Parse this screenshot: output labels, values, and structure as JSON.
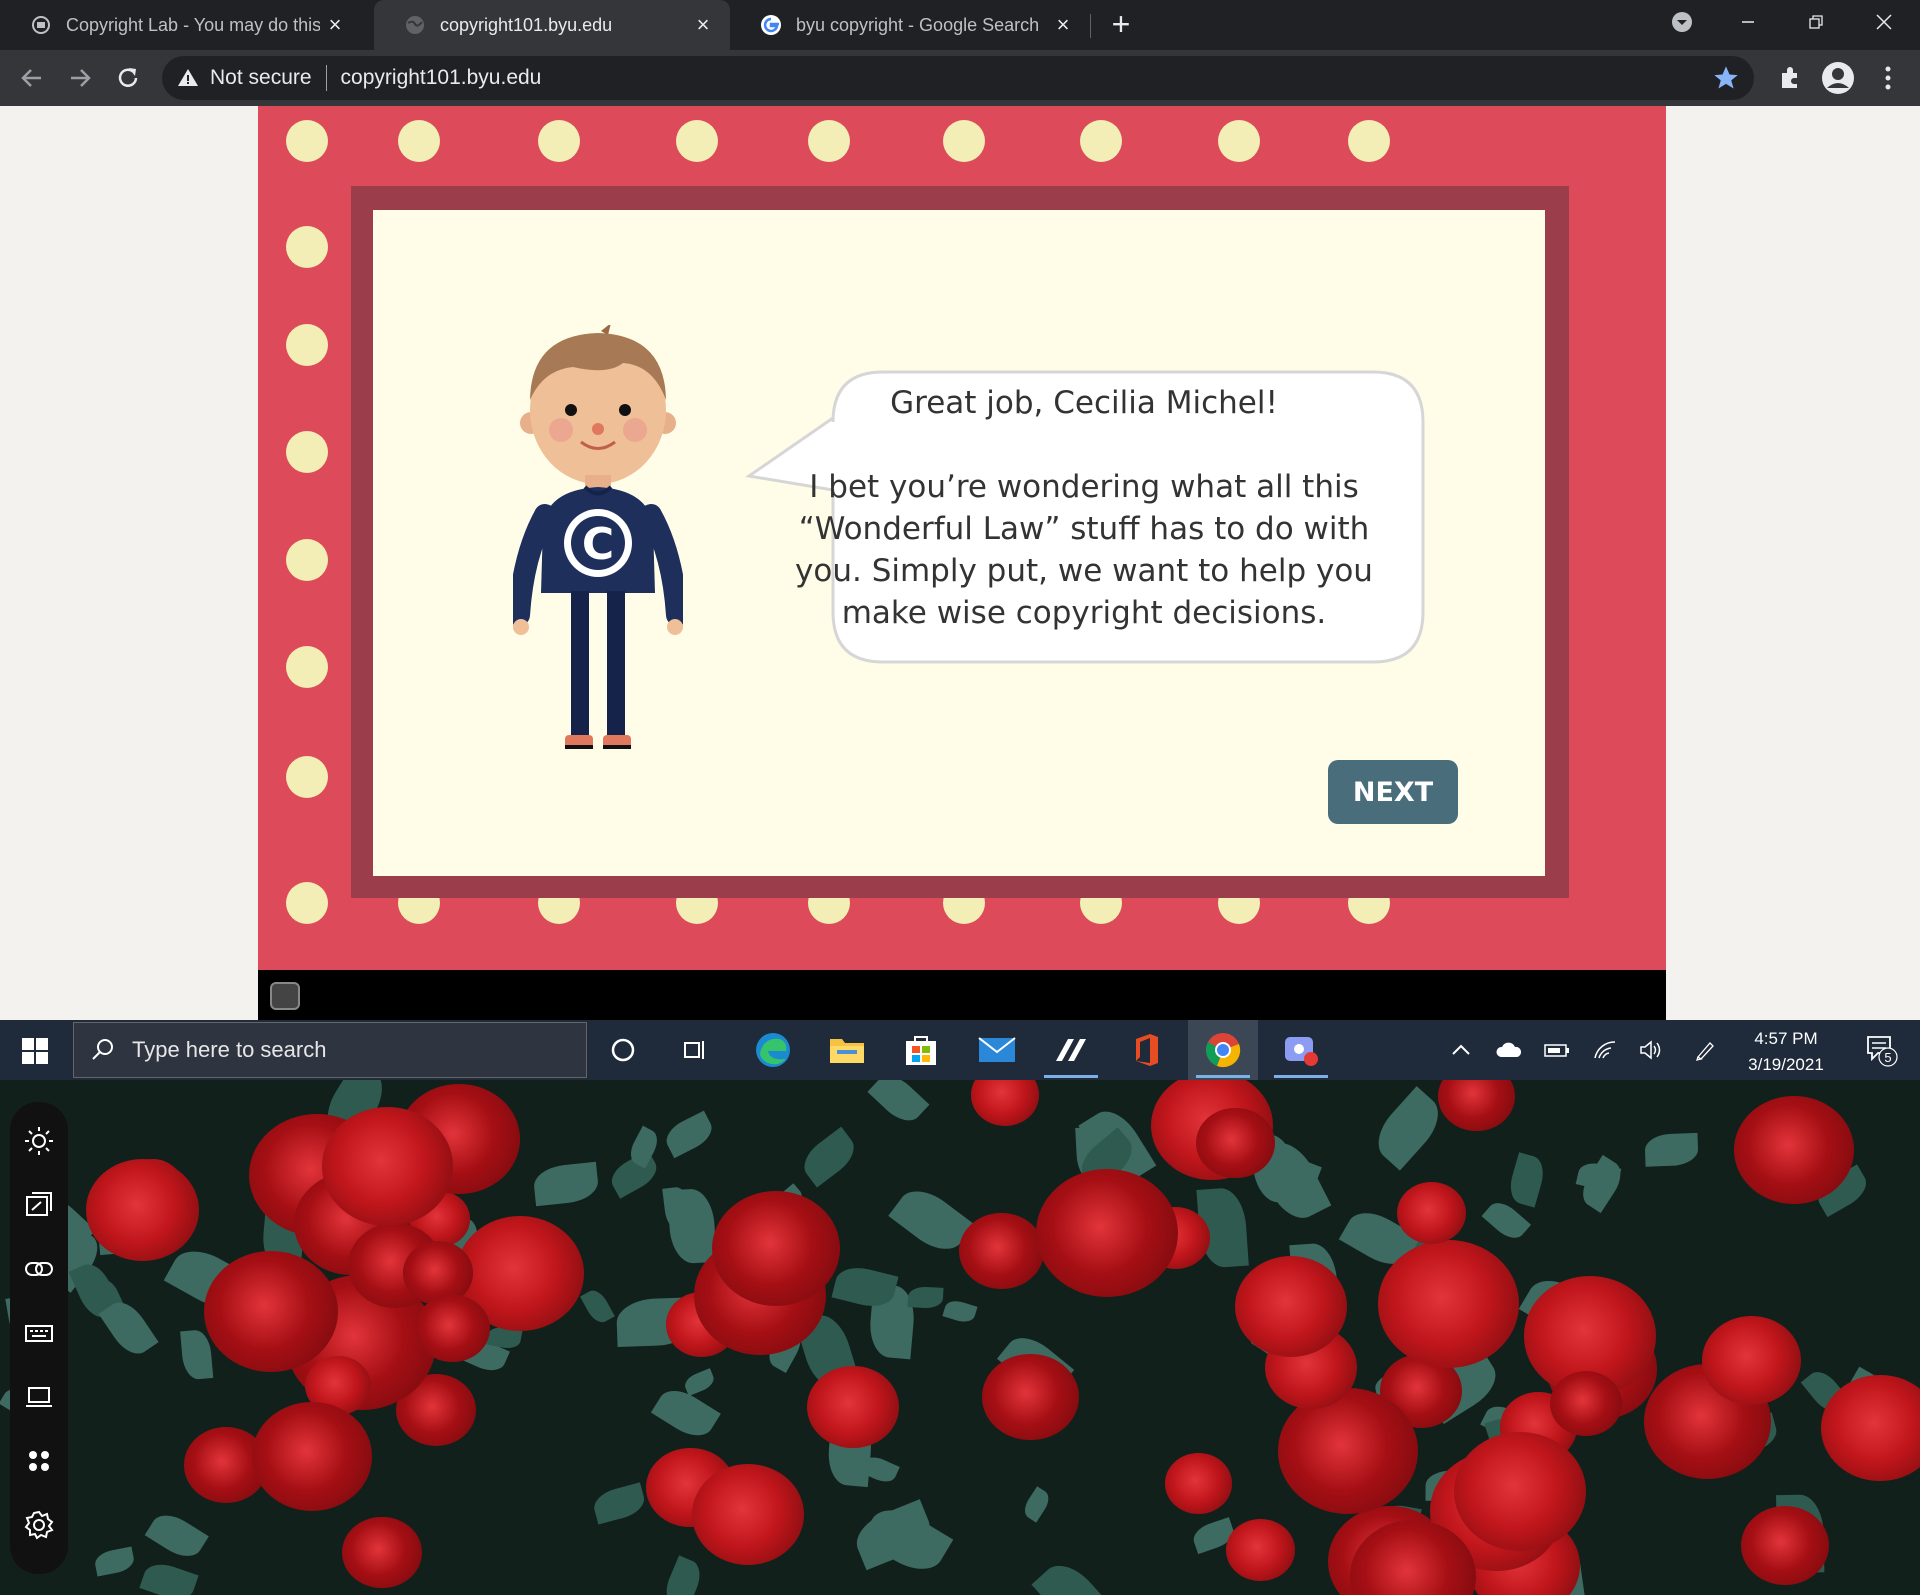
{
  "browser": {
    "tabs": [
      {
        "title": "Copyright Lab - You may do this",
        "active": false
      },
      {
        "title": "copyright101.byu.edu",
        "active": true
      },
      {
        "title": "byu copyright - Google Search",
        "active": false
      }
    ],
    "security_label": "Not secure",
    "url": "copyright101.byu.edu"
  },
  "lesson": {
    "greeting": "Great job, Cecilia Michel!",
    "message": "I bet you’re wondering what all this “Wonderful Law” stuff has to do with you. Simply put, we want to help you make wise copyright decisions.",
    "next_label": "NEXT",
    "character_emblem": "C"
  },
  "taskbar": {
    "search_placeholder": "Type here to search",
    "time": "4:57 PM",
    "date": "3/19/2021",
    "notification_count": "5"
  },
  "colors": {
    "stage": "#dd4a5a",
    "frame": "#9b3d4b",
    "panel": "#fffde8",
    "dots": "#f2eeb6",
    "next_button": "#4a6d7c"
  }
}
